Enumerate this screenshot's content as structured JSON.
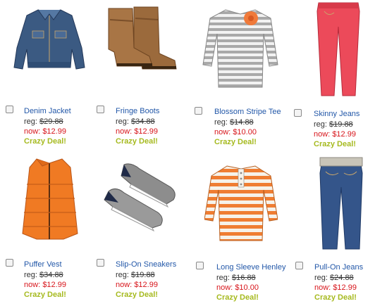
{
  "products": [
    {
      "name": "Denim Jacket",
      "reg_label": "reg:",
      "reg_price": "$29.88",
      "now_label": "now:",
      "now_price": "$12.99",
      "badge": "Crazy Deal!"
    },
    {
      "name": "Fringe Boots",
      "reg_label": "reg:",
      "reg_price": "$34.88",
      "now_label": "now:",
      "now_price": "$12.99",
      "badge": "Crazy Deal!"
    },
    {
      "name": "Blossom Stripe Tee",
      "reg_label": "reg:",
      "reg_price": "$14.88",
      "now_label": "now:",
      "now_price": "$10.00",
      "badge": "Crazy Deal!"
    },
    {
      "name": "Skinny Jeans",
      "reg_label": "reg:",
      "reg_price": "$19.88",
      "now_label": "now:",
      "now_price": "$12.99",
      "badge": "Crazy Deal!"
    },
    {
      "name": "Puffer Vest",
      "reg_label": "reg:",
      "reg_price": "$34.88",
      "now_label": "now:",
      "now_price": "$12.99",
      "badge": "Crazy Deal!"
    },
    {
      "name": "Slip-On Sneakers",
      "reg_label": "reg:",
      "reg_price": "$19.88",
      "now_label": "now:",
      "now_price": "$12.99",
      "badge": "Crazy Deal!"
    },
    {
      "name": "Long Sleeve Henley",
      "reg_label": "reg:",
      "reg_price": "$16.88",
      "now_label": "now:",
      "now_price": "$10.00",
      "badge": "Crazy Deal!"
    },
    {
      "name": "Pull-On Jeans",
      "reg_label": "reg:",
      "reg_price": "$24.88",
      "now_label": "now:",
      "now_price": "$12.99",
      "badge": "Crazy Deal!"
    }
  ],
  "colors": {
    "name_link": "#2257a8",
    "sale_price": "#d7141a",
    "deal_badge": "#a6ba1f"
  },
  "images": [
    "denim-jacket",
    "brown-fringe-boots",
    "gray-striped-tee-with-flower",
    "red-skinny-jeans",
    "orange-puffer-vest",
    "gray-slip-on-sneakers",
    "orange-striped-henley",
    "blue-pull-on-jeans"
  ]
}
